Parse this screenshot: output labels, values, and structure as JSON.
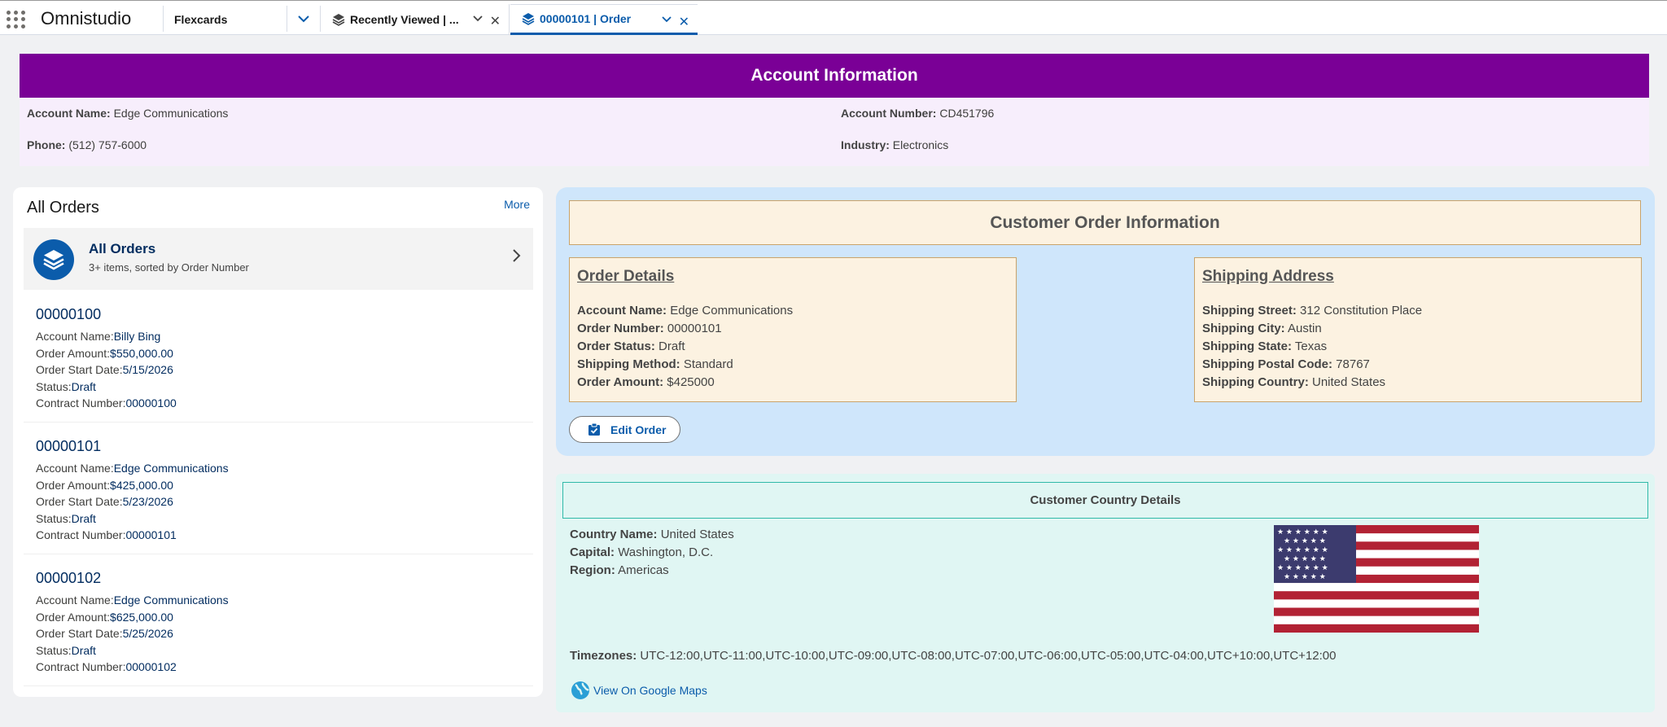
{
  "app": {
    "name": "Omnistudio"
  },
  "nav": {
    "selected": "Flexcards"
  },
  "tabs": [
    {
      "label": "Recently Viewed | ...",
      "active": false
    },
    {
      "label": "00000101 | Order",
      "active": true
    }
  ],
  "account": {
    "title": "Account Information",
    "name_label": "Account Name:",
    "name": "Edge Communications",
    "phone_label": "Phone:",
    "phone": "(512) 757-6000",
    "number_label": "Account Number:",
    "number": "CD451796",
    "industry_label": "Industry:",
    "industry": "Electronics"
  },
  "orders": {
    "title": "All Orders",
    "more": "More",
    "list_title": "All Orders",
    "list_subtitle": "3+ items, sorted by Order Number",
    "labels": {
      "account": "Account Name:",
      "amount": "Order Amount:",
      "start": "Order Start Date:",
      "status": "Status:",
      "contract": "Contract Number:"
    },
    "items": [
      {
        "number": "00000100",
        "account": "Billy Bing",
        "amount": "$550,000.00",
        "start": "5/15/2026",
        "status": "Draft",
        "contract": "00000100"
      },
      {
        "number": "00000101",
        "account": "Edge Communications",
        "amount": "$425,000.00",
        "start": "5/23/2026",
        "status": "Draft",
        "contract": "00000101"
      },
      {
        "number": "00000102",
        "account": "Edge Communications",
        "amount": "$625,000.00",
        "start": "5/25/2026",
        "status": "Draft",
        "contract": "00000102"
      }
    ]
  },
  "customer_order": {
    "title": "Customer Order Information",
    "details": {
      "title": "Order Details",
      "account_label": "Account Name:",
      "account": "Edge Communications",
      "number_label": "Order Number:",
      "number": "00000101",
      "status_label": "Order Status:",
      "status": "Draft",
      "method_label": "Shipping Method:",
      "method": "Standard",
      "amount_label": "Order Amount:",
      "amount": "$425000"
    },
    "shipping": {
      "title": "Shipping Address",
      "street_label": "Shipping Street:",
      "street": "312 Constitution Place",
      "city_label": "Shipping City:",
      "city": "Austin",
      "state_label": "Shipping State:",
      "state": "Texas",
      "postal_label": "Shipping Postal Code:",
      "postal": "78767",
      "country_label": "Shipping Country:",
      "country": "United States"
    },
    "edit_button": "Edit Order"
  },
  "country": {
    "title": "Customer Country Details",
    "name_label": "Country Name:",
    "name": "United States",
    "capital_label": "Capital:",
    "capital": "Washington, D.C.",
    "region_label": "Region:",
    "region": "Americas",
    "timezones_label": "Timezones:",
    "timezones": "UTC-12:00,UTC-11:00,UTC-10:00,UTC-09:00,UTC-08:00,UTC-07:00,UTC-06:00,UTC-05:00,UTC-04:00,UTC+10:00,UTC+12:00",
    "maps_link": "View On Google Maps"
  },
  "colors": {
    "brand_blue": "#0b5cab",
    "header_purple": "#7a0096",
    "flag_red": "#b22234",
    "flag_blue": "#3c3b6e"
  }
}
